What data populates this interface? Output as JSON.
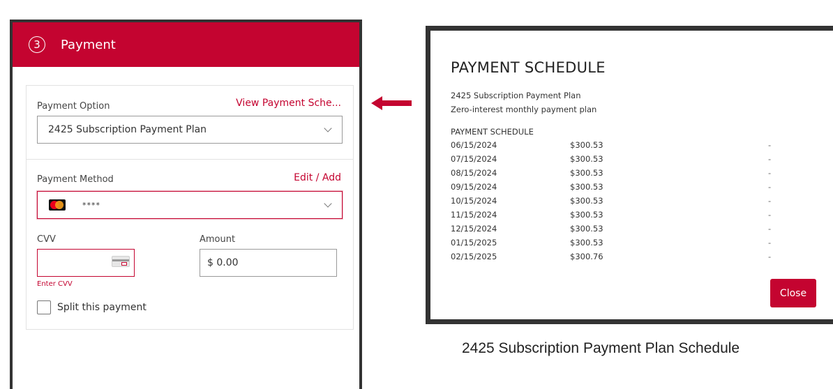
{
  "payment_panel": {
    "step_number": "3",
    "title": "Payment",
    "payment_option": {
      "label": "Payment Option",
      "link": "View Payment Sche...",
      "selected": "2425 Subscription Payment Plan"
    },
    "payment_method": {
      "label": "Payment Method",
      "link": "Edit / Add",
      "card_masked": "****",
      "card_icon": "mastercard-icon"
    },
    "cvv": {
      "label": "CVV",
      "value": "",
      "error": "Enter CVV",
      "icon": "card-cvv-icon"
    },
    "amount": {
      "label": "Amount",
      "value": "$ 0.00"
    },
    "split": {
      "label": "Split this payment",
      "checked": false
    }
  },
  "arrow": {
    "icon": "arrow-left-icon",
    "color": "#c40430"
  },
  "modal": {
    "title": "PAYMENT SCHEDULE",
    "plan_name": "2425 Subscription Payment Plan",
    "plan_desc": "Zero-interest monthly payment plan",
    "schedule_heading": "PAYMENT SCHEDULE",
    "rows": [
      {
        "date": "06/15/2024",
        "amount": "$300.53",
        "status": "-"
      },
      {
        "date": "07/15/2024",
        "amount": "$300.53",
        "status": "-"
      },
      {
        "date": "08/15/2024",
        "amount": "$300.53",
        "status": "-"
      },
      {
        "date": "09/15/2024",
        "amount": "$300.53",
        "status": "-"
      },
      {
        "date": "10/15/2024",
        "amount": "$300.53",
        "status": "-"
      },
      {
        "date": "11/15/2024",
        "amount": "$300.53",
        "status": "-"
      },
      {
        "date": "12/15/2024",
        "amount": "$300.53",
        "status": "-"
      },
      {
        "date": "01/15/2025",
        "amount": "$300.53",
        "status": "-"
      },
      {
        "date": "02/15/2025",
        "amount": "$300.76",
        "status": "-"
      }
    ],
    "close_label": "Close"
  },
  "caption": "2425 Subscription Payment Plan Schedule",
  "colors": {
    "brand_red": "#c40430",
    "frame": "#333333"
  }
}
